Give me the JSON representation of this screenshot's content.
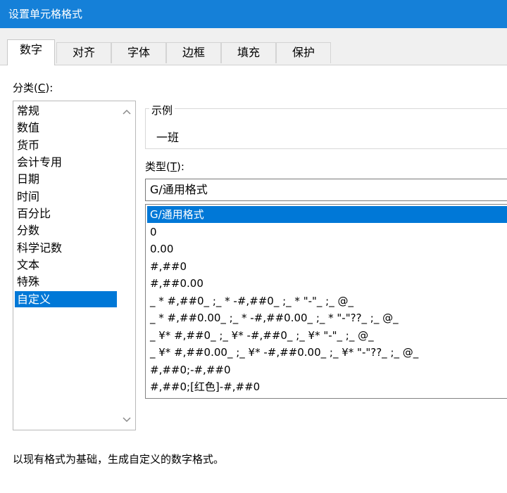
{
  "window": {
    "title": "设置单元格格式"
  },
  "tabs": [
    {
      "label": "数字"
    },
    {
      "label": "对齐"
    },
    {
      "label": "字体"
    },
    {
      "label": "边框"
    },
    {
      "label": "填充"
    },
    {
      "label": "保护"
    }
  ],
  "category": {
    "label_prefix": "分类(",
    "label_key": "C",
    "label_suffix": "):",
    "items": [
      "常规",
      "数值",
      "货币",
      "会计专用",
      "日期",
      "时间",
      "百分比",
      "分数",
      "科学记数",
      "文本",
      "特殊",
      "自定义"
    ],
    "selected": "自定义"
  },
  "sample": {
    "legend": "示例",
    "value": "一班"
  },
  "type": {
    "label_prefix": "类型(",
    "label_key": "T",
    "label_suffix": "):",
    "input_value": "G/通用格式",
    "items": [
      "G/通用格式",
      "0",
      "0.00",
      "#,##0",
      "#,##0.00",
      "_ * #,##0_ ;_ * -#,##0_ ;_ * \"-\"_ ;_ @_",
      "_ * #,##0.00_ ;_ * -#,##0.00_ ;_ * \"-\"??_ ;_ @_",
      "_ ¥* #,##0_ ;_ ¥* -#,##0_ ;_ ¥* \"-\"_ ;_ @_",
      "_ ¥* #,##0.00_ ;_ ¥* -#,##0.00_ ;_ ¥* \"-\"??_ ;_ @_",
      "#,##0;-#,##0",
      "#,##0;[红色]-#,##0"
    ],
    "selected": "G/通用格式"
  },
  "description": "以现有格式为基础，生成自定义的数字格式。",
  "colors": {
    "titlebar": "#1580d8",
    "selection": "#0078d7"
  }
}
